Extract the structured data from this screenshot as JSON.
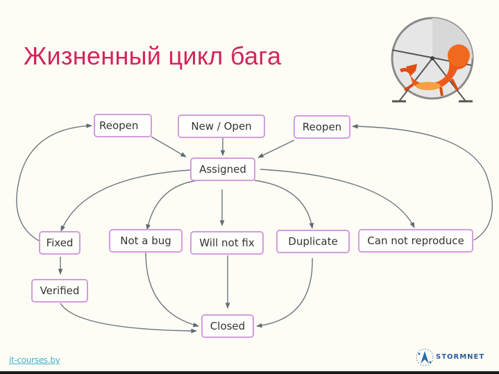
{
  "title": "Жизненный цикл бага",
  "nodes": {
    "reopen_left": "Reopen",
    "new_open": "New / Open",
    "reopen_right": "Reopen",
    "assigned": "Assigned",
    "fixed": "Fixed",
    "not_a_bug": "Not a bug",
    "will_not_fix": "Will not fix",
    "duplicate": "Duplicate",
    "can_not_reproduce": "Can not reproduce",
    "verified": "Verified",
    "closed": "Closed"
  },
  "edges": [
    [
      "new_open",
      "assigned"
    ],
    [
      "reopen_left",
      "assigned"
    ],
    [
      "reopen_right",
      "assigned"
    ],
    [
      "assigned",
      "fixed"
    ],
    [
      "assigned",
      "not_a_bug"
    ],
    [
      "assigned",
      "will_not_fix"
    ],
    [
      "assigned",
      "duplicate"
    ],
    [
      "assigned",
      "can_not_reproduce"
    ],
    [
      "fixed",
      "reopen_left"
    ],
    [
      "can_not_reproduce",
      "reopen_right"
    ],
    [
      "fixed",
      "verified"
    ],
    [
      "verified",
      "closed"
    ],
    [
      "not_a_bug",
      "closed"
    ],
    [
      "will_not_fix",
      "closed"
    ],
    [
      "duplicate",
      "closed"
    ]
  ],
  "colors": {
    "title": "#d4245e",
    "node_border": "#d49bde",
    "edge": "#6b7680",
    "link": "#3fb0d0"
  },
  "footer": {
    "link_text": "it-courses.by",
    "logo_text": "STORMNET"
  },
  "mascot": "hamster-wheel-dragon-image"
}
